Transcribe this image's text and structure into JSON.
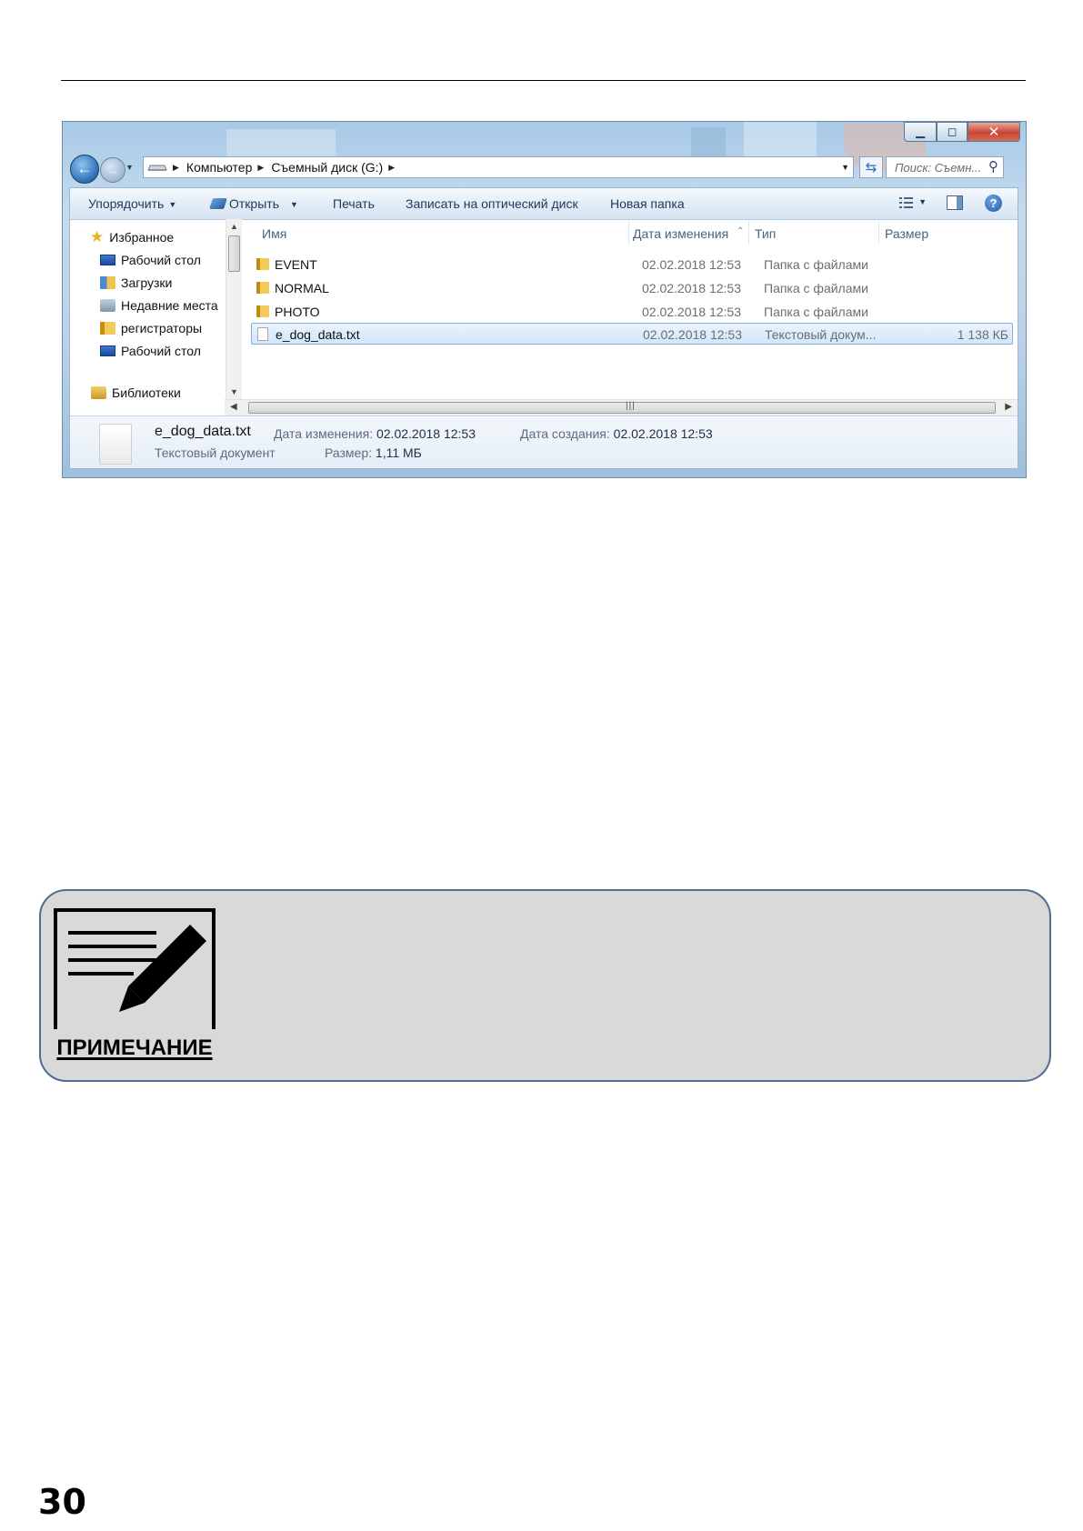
{
  "explorer": {
    "breadcrumb": [
      "Компьютер",
      "Съемный диск (G:)"
    ],
    "search_placeholder": "Поиск: Съемн...",
    "toolbar": {
      "organize": "Упорядочить",
      "open": "Открыть",
      "print": "Печать",
      "burn": "Записать на оптический диск",
      "new_folder": "Новая папка"
    },
    "nav": {
      "favorites": "Избранное",
      "desktop1": "Рабочий стол",
      "downloads": "Загрузки",
      "recent": "Недавние места",
      "recorders": "регистраторы",
      "desktop2": "Рабочий стол",
      "libraries": "Библиотеки"
    },
    "columns": {
      "name": "Имя",
      "date": "Дата изменения",
      "type": "Тип",
      "size": "Размер"
    },
    "files": [
      {
        "name": "EVENT",
        "date": "02.02.2018 12:53",
        "type": "Папка с файлами",
        "size": "",
        "icon": "folder-icon"
      },
      {
        "name": "NORMAL",
        "date": "02.02.2018 12:53",
        "type": "Папка с файлами",
        "size": "",
        "icon": "folder-icon"
      },
      {
        "name": "PHOTO",
        "date": "02.02.2018 12:53",
        "type": "Папка с файлами",
        "size": "",
        "icon": "folder-icon"
      },
      {
        "name": "e_dog_data.txt",
        "date": "02.02.2018 12:53",
        "type": "Текстовый докум...",
        "size": "1 138 КБ",
        "icon": "text-file-icon",
        "selected": true
      }
    ],
    "details": {
      "name": "e_dog_data.txt",
      "kind": "Текстовый документ",
      "modified_label": "Дата изменения:",
      "modified_value": "02.02.2018 12:53",
      "size_label": "Размер:",
      "size_value": "1,11 МБ",
      "created_label": "Дата создания:",
      "created_value": "02.02.2018 12:53"
    }
  },
  "note": {
    "label": "ПРИМЕЧАНИЕ",
    "icon": "note-pencil-icon"
  },
  "page_number": "30"
}
